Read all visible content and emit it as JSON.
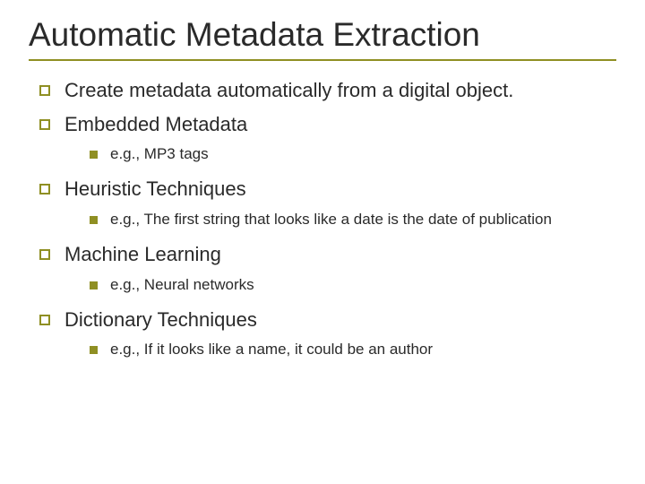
{
  "title": "Automatic Metadata Extraction",
  "bullets": [
    {
      "text": "Create metadata automatically from a digital object."
    },
    {
      "text": "Embedded Metadata",
      "sub": [
        {
          "text": "e.g., MP3 tags"
        }
      ]
    },
    {
      "text": "Heuristic Techniques",
      "sub": [
        {
          "text": "e.g., The first string that looks like a date is the date of publication"
        }
      ]
    },
    {
      "text": "Machine Learning",
      "sub": [
        {
          "text": "e.g., Neural networks"
        }
      ]
    },
    {
      "text": "Dictionary Techniques",
      "sub": [
        {
          "text": "e.g., If it looks like a name, it could be an author"
        }
      ]
    }
  ]
}
